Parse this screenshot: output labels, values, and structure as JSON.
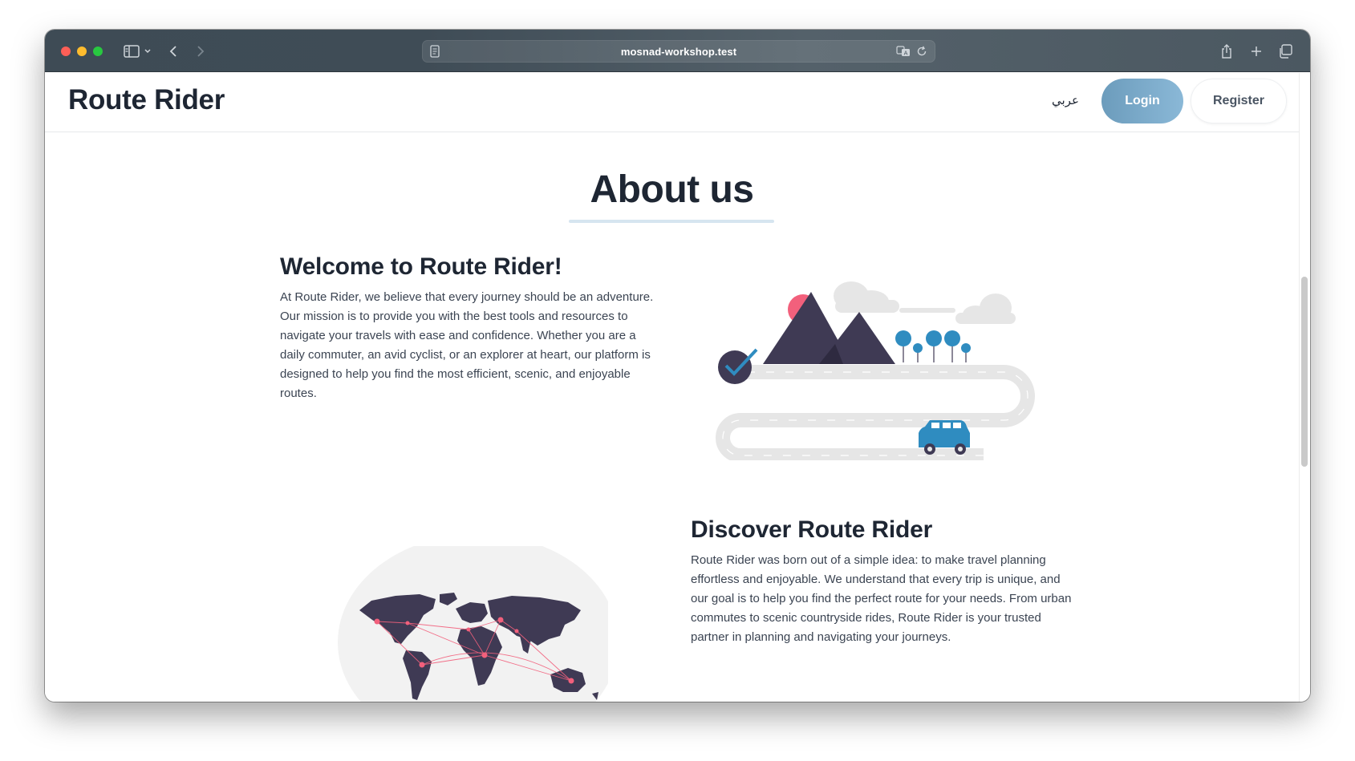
{
  "browser": {
    "url": "mosnad-workshop.test"
  },
  "navbar": {
    "brand": "Route Rider",
    "language_link": "عربي",
    "login_label": "Login",
    "register_label": "Register"
  },
  "about": {
    "title": "About us",
    "welcome": {
      "heading": "Welcome to Route Rider!",
      "body": "At Route Rider, we believe that every journey should be an adventure. Our mission is to provide you with the best tools and resources to navigate your travels with ease and confidence. Whether you are a daily commuter, an avid cyclist, or an explorer at heart, our platform is designed to help you find the most efficient, scenic, and enjoyable routes."
    },
    "discover": {
      "heading": "Discover Route Rider",
      "body": "Route Rider was born out of a simple idea: to make travel planning effortless and enjoyable. We understand that every trip is unique, and our goal is to help you find the perfect route for your needs. From urban commutes to scenic countryside rides, Route Rider is your trusted partner in planning and navigating your journeys."
    }
  },
  "icons": {
    "sidebar": "sidebar-icon",
    "back": "chevron-left-icon",
    "forward": "chevron-right-icon",
    "reader": "reader-icon",
    "translate": "translate-icon",
    "reload": "reload-icon",
    "share": "share-icon",
    "new_tab": "plus-icon",
    "tabs": "tabs-overview-icon"
  },
  "colors": {
    "login_button": "#7eabc9",
    "heading": "#1e2633",
    "illustration_dark": "#3f3a54",
    "illustration_blue": "#2f8cc0",
    "illustration_pink": "#f2607c"
  }
}
